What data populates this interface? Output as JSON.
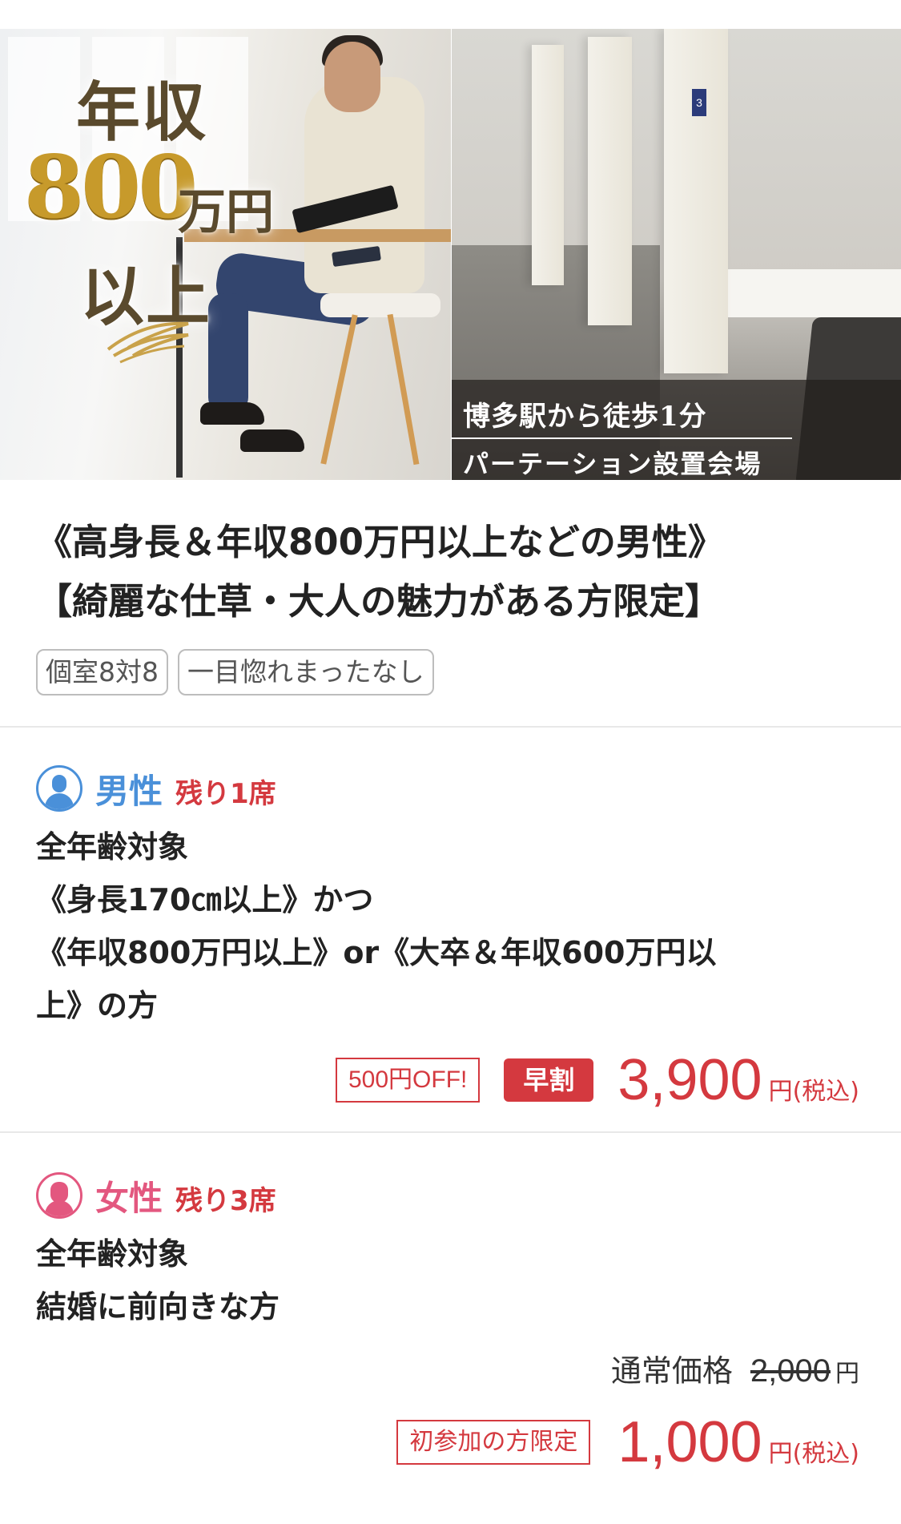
{
  "hero": {
    "catch_line1": "年収",
    "catch_amount": "800",
    "catch_unit": "万円",
    "catch_line3": "以上",
    "access_line1": "博多駅から徒歩1分",
    "access_line2": "パーテーション設置会場",
    "booth_numbers": [
      "3"
    ]
  },
  "event": {
    "title_line1": "《高身長＆年収800万円以上などの男性》",
    "title_line2": "【綺麗な仕草・大人の魅力がある方限定】",
    "tags": [
      "個室8対8",
      "一目惚れまったなし"
    ]
  },
  "male": {
    "icon": "male-avatar-icon",
    "label": "男性",
    "seats_left": "残り1席",
    "conditions": [
      "全年齢対象",
      "《身長170㎝以上》かつ",
      "《年収800万円以上》or《大卒＆年収600万円以",
      "上》の方"
    ],
    "discount_badge": "500円OFF!",
    "early_badge": "早割",
    "price": "3,900",
    "price_unit": "円(税込)"
  },
  "female": {
    "icon": "female-avatar-icon",
    "label": "女性",
    "seats_left": "残り3席",
    "conditions": [
      "全年齢対象",
      "結婚に前向きな方"
    ],
    "normal_label": "通常価格",
    "normal_price": "2,000",
    "normal_unit": "円",
    "first_time_badge": "初参加の方限定",
    "price": "1,000",
    "price_unit": "円(税込)"
  },
  "colors": {
    "male_accent": "#4a90d9",
    "female_accent": "#e3577f",
    "price_red": "#d4393f"
  }
}
